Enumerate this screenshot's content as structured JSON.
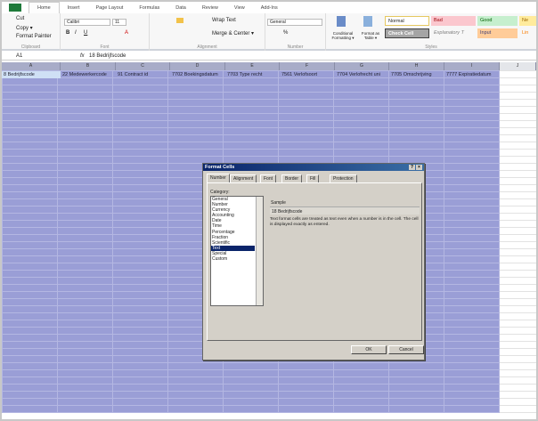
{
  "ribbon_tabs": [
    "Home",
    "Insert",
    "Page Layout",
    "Formulas",
    "Data",
    "Review",
    "View",
    "Add-Ins"
  ],
  "clipboard": {
    "cut": "Cut",
    "copy": "Copy ▾",
    "format_painter": "Format Painter",
    "label": "Clipboard"
  },
  "font": {
    "name": "Calibri",
    "size": "11",
    "label": "Font"
  },
  "alignment": {
    "wrap": "Wrap Text",
    "merge": "Merge & Center ▾",
    "label": "Alignment"
  },
  "number": {
    "format": "General",
    "label": "Number",
    "percent": "%"
  },
  "styles": {
    "conditional": "Conditional Formatting ▾",
    "format_table": "Format as Table ▾",
    "normal": "Normal",
    "bad": "Bad",
    "good": "Good",
    "neutral": "Ne",
    "check_cell": "Check Cell",
    "explanatory": "Explanatory T",
    "input": "Input",
    "linked": "Lin",
    "label": "Styles"
  },
  "formula_bar": {
    "name_box": "A1",
    "fx": "fx",
    "value": "18 Bedrijfscode"
  },
  "columns": [
    "A",
    "B",
    "C",
    "D",
    "E",
    "F",
    "G",
    "H",
    "I",
    "J"
  ],
  "row1": [
    "8 Bedrijfscode",
    "22 Medewerkercode",
    "91 Contract id",
    "7702 Boekingsdatum",
    "7703 Type recht",
    "7561 Verlofsoort",
    "7704 Verlofrecht uni",
    "7705 Omschrijving",
    "7777 Expiratiedatum"
  ],
  "dialog": {
    "title": "Format Cells",
    "help": "?",
    "close": "×",
    "tabs": [
      "Number",
      "Alignment",
      "Font",
      "Border",
      "Fill",
      "Protection"
    ],
    "category_label": "Category:",
    "categories": [
      "General",
      "Number",
      "Currency",
      "Accounting",
      "Date",
      "Time",
      "Percentage",
      "Fraction",
      "Scientific",
      "Text",
      "Special",
      "Custom"
    ],
    "sample_label": "Sample",
    "sample_value": "18 Bedrijfscode",
    "description": "Text format cells are treated as text even when a number is in the cell. The cell is displayed exactly as entered.",
    "ok": "OK",
    "cancel": "Cancel"
  }
}
